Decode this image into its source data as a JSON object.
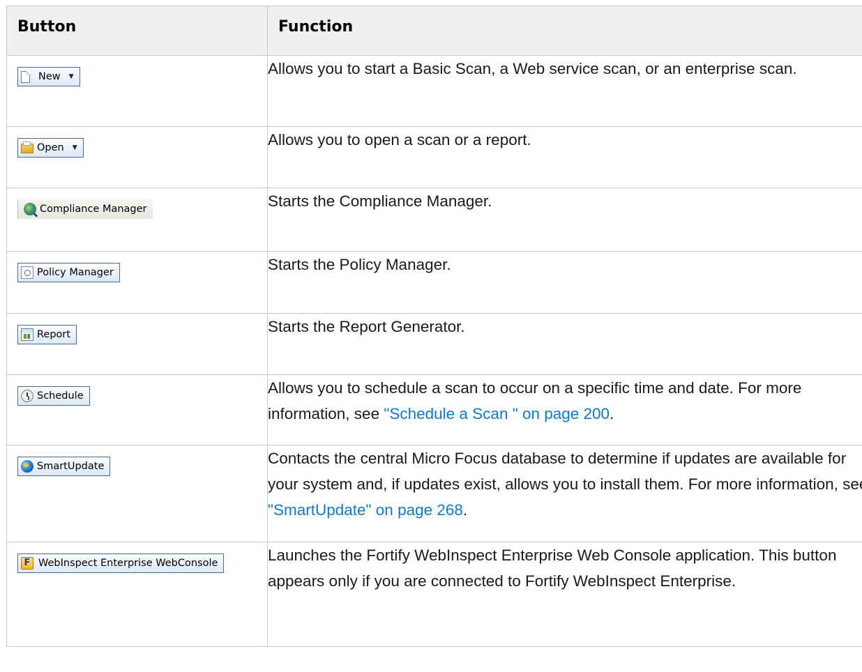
{
  "table": {
    "headers": {
      "button": "Button",
      "function": "Function"
    },
    "rows": [
      {
        "button_label": "New",
        "icon": "new-document-icon",
        "has_dropdown": true,
        "description": "Allows you to start a Basic Scan, a Web service scan, or an enterprise scan."
      },
      {
        "button_label": "Open",
        "icon": "open-folder-icon",
        "has_dropdown": true,
        "description": "Allows you to open a scan or a report."
      },
      {
        "button_label": "Compliance Manager",
        "icon": "compliance-magnifier-icon",
        "description": "Starts the Compliance Manager."
      },
      {
        "button_label": "Policy Manager",
        "icon": "policy-document-icon",
        "description": "Starts the Policy Manager."
      },
      {
        "button_label": "Report",
        "icon": "report-icon",
        "description": "Starts the Report Generator."
      },
      {
        "button_label": "Schedule",
        "icon": "clock-icon",
        "description_before": "Allows you to schedule a scan to occur on a specific time and date. For more information, see ",
        "link_text": "\"Schedule a Scan \" on page 200",
        "description_after": "."
      },
      {
        "button_label": "SmartUpdate",
        "icon": "globe-update-icon",
        "description_before": "Contacts the central Micro Focus database to determine if updates are available for your system and, if updates exist, allows you to install them. For more information, see ",
        "link_text": "\"SmartUpdate\" on page 268",
        "description_after": "."
      },
      {
        "button_label": "WebInspect Enterprise WebConsole",
        "icon": "fortify-logo-icon",
        "icon_letter": "F",
        "description": "Launches the Fortify WebInspect Enterprise Web Console application. This button appears only if you are connected to Fortify WebInspect Enterprise."
      }
    ]
  },
  "colors": {
    "header_background": "#efefef",
    "link": "#0a7bd8",
    "button_border": "#4b6b96"
  }
}
